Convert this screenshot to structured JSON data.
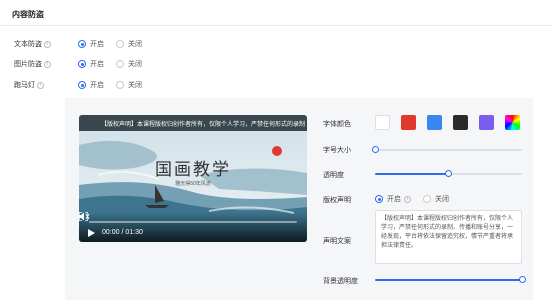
{
  "page": {
    "title": "内容防盗"
  },
  "settings": {
    "text_protect": {
      "label": "文本防盗",
      "options": [
        "开启",
        "关闭"
      ],
      "selected": "开启"
    },
    "image_protect": {
      "label": "图片防盗",
      "options": [
        "开启",
        "关闭"
      ],
      "selected": "开启"
    },
    "marquee": {
      "label": "跑马灯",
      "options": [
        "开启",
        "关闭"
      ],
      "selected": "开启"
    }
  },
  "preview": {
    "marquee_text": "【版权声明】本课程版权归创作者所有，仅限个人学习，严禁任何形式的录制",
    "painting_title": "国画教学",
    "painting_subtitle": "雅无得50年风流",
    "time": "00:00 / 01:30",
    "progress": 0
  },
  "marquee_settings": {
    "font_color": {
      "label": "字体颜色",
      "swatches": [
        "#ffffff",
        "#e03a2f",
        "#3a85f0",
        "#2b2b2b",
        "#7b5cf0",
        "rainbow"
      ],
      "selected": "#ffffff"
    },
    "font_size": {
      "label": "字号大小",
      "value": 0
    },
    "opacity": {
      "label": "透明度",
      "value": 0.5
    },
    "copyright": {
      "label": "版权声明",
      "options": [
        "开启",
        "关闭"
      ],
      "selected": "开启"
    },
    "copyright_text": {
      "label": "声明文案",
      "value": "【版权声明】本课程版权归创作者所有，仅限个人学习，严禁任何形式的录制、传播和账号分享，一经发现，平台将依法保留追究权，情节严重者将承担法律责任。"
    },
    "bg_opacity": {
      "label": "背景透明度",
      "value": 1.0
    }
  }
}
